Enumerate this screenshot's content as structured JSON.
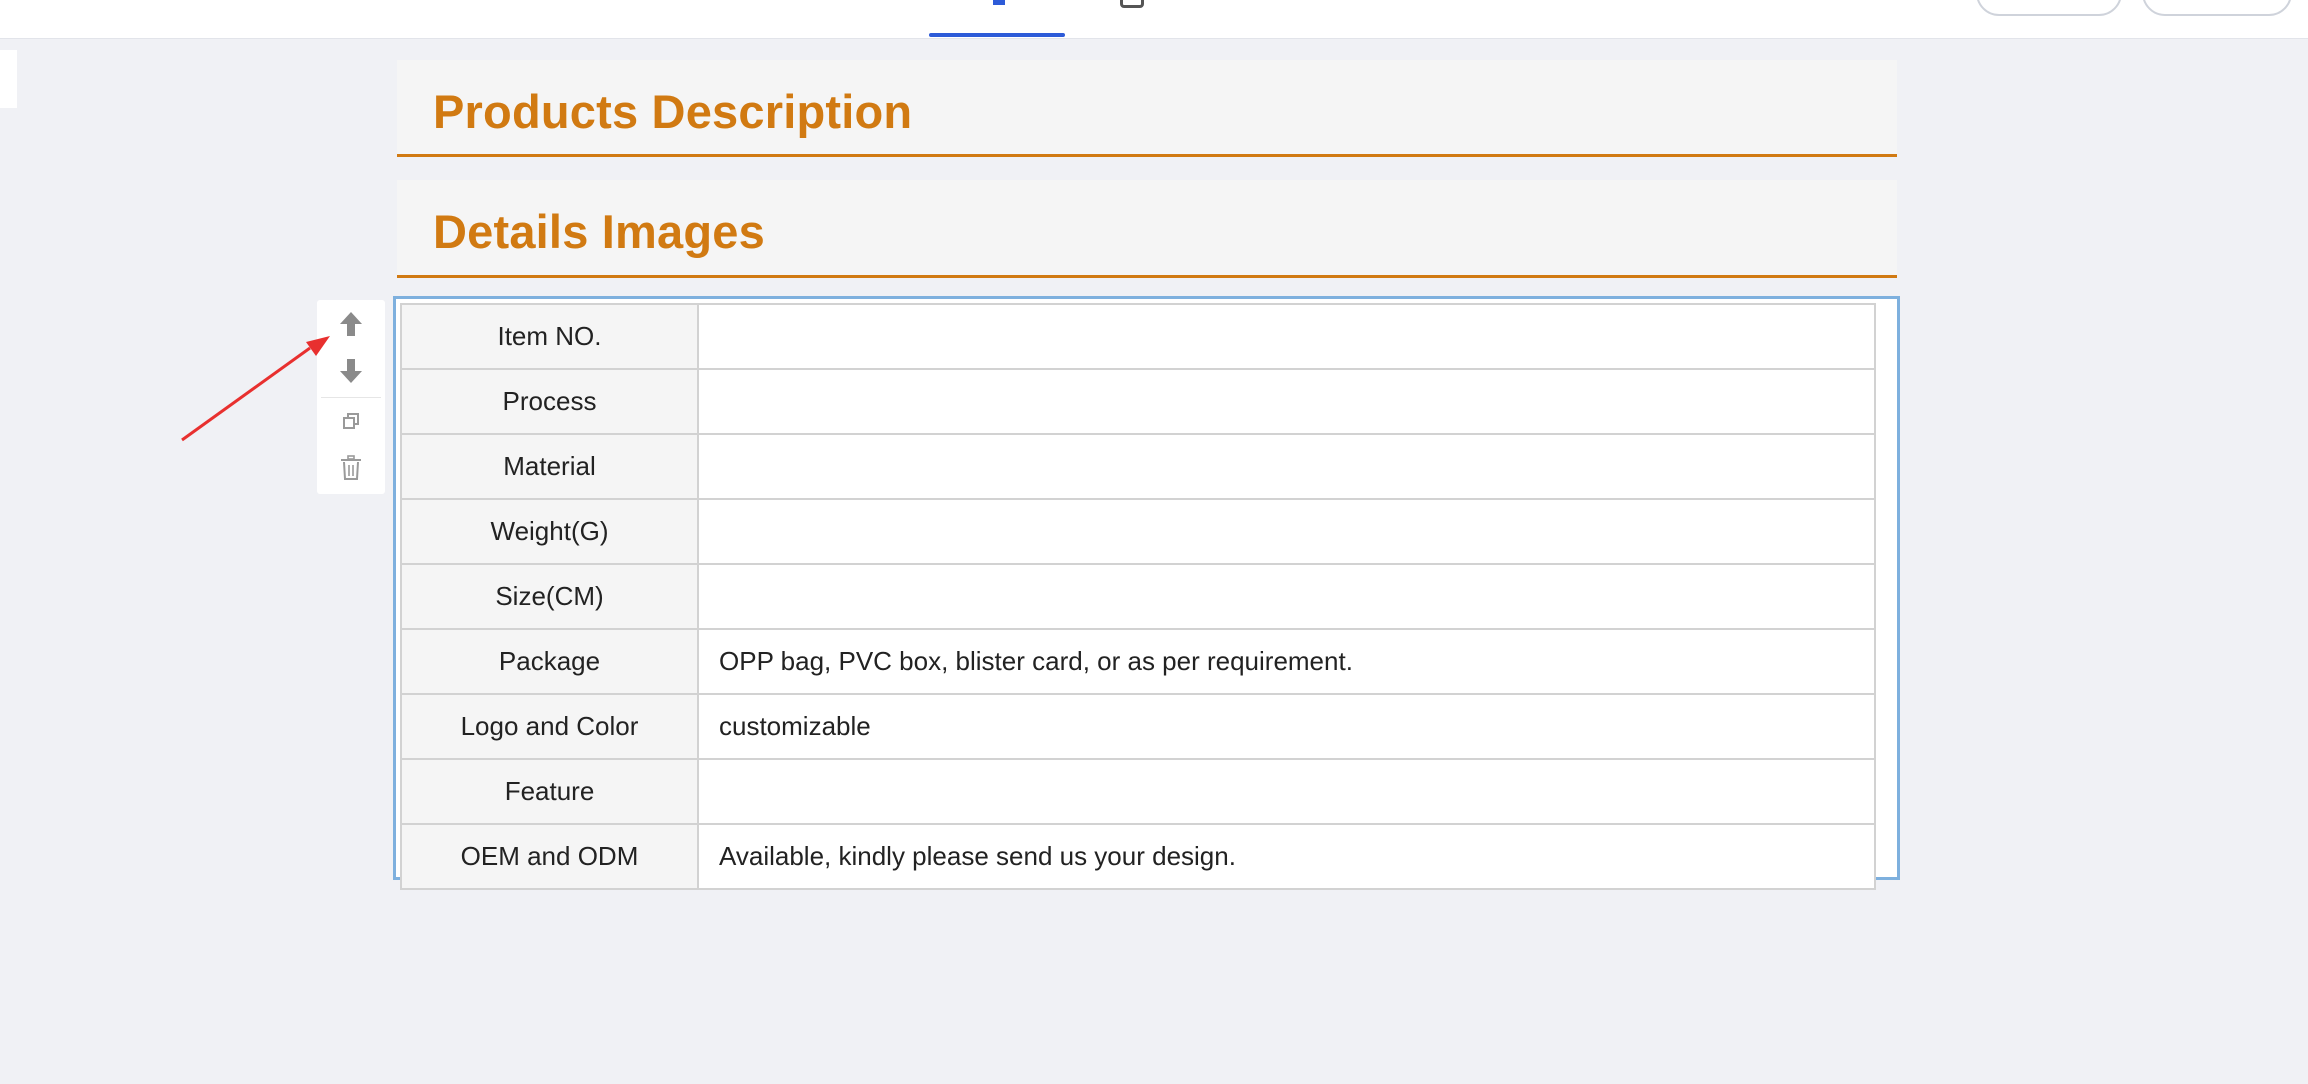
{
  "toolbar": {
    "tabs_visible": 2,
    "buttons": [
      "",
      ""
    ]
  },
  "sections": [
    {
      "title": "Products Description"
    },
    {
      "title": "Details Images"
    }
  ],
  "block_toolbar": {
    "icons": [
      "arrow-up-icon",
      "arrow-down-icon",
      "copy-icon",
      "trash-icon"
    ]
  },
  "spec_table": {
    "rows": [
      {
        "label": "Item NO.",
        "value": ""
      },
      {
        "label": "Process",
        "value": ""
      },
      {
        "label": "Material",
        "value": ""
      },
      {
        "label": "Weight(G)",
        "value": ""
      },
      {
        "label": "Size(CM)",
        "value": ""
      },
      {
        "label": "Package",
        "value": "OPP bag, PVC box, blister card, or as per requirement."
      },
      {
        "label": "Logo and Color",
        "value": "customizable"
      },
      {
        "label": "Feature",
        "value": ""
      },
      {
        "label": "OEM and ODM",
        "value": "Available, kindly please send us your design."
      }
    ]
  },
  "colors": {
    "accent_orange": "#d17a12",
    "selection_blue": "#7eb0de",
    "tab_blue": "#2d5bd8",
    "annotation_red": "#e8302f"
  }
}
